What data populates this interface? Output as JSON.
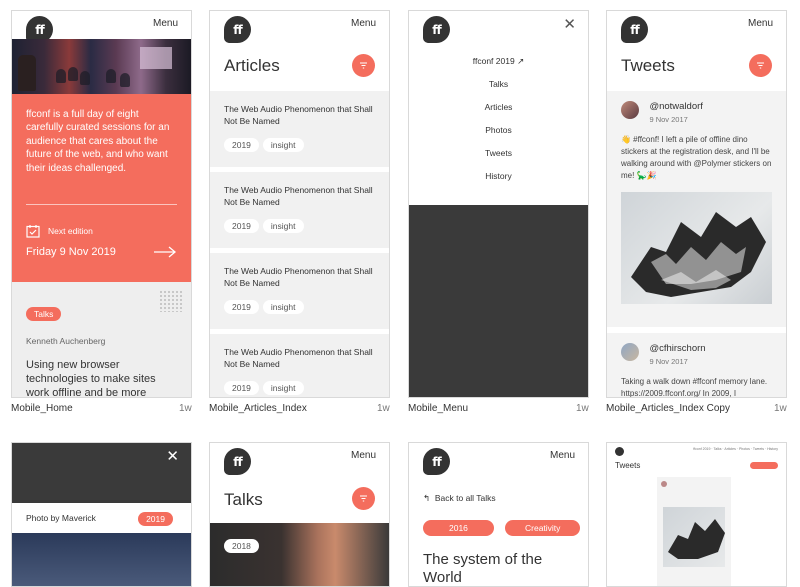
{
  "brand": {
    "logo_text": "ff",
    "coral": "#f46d5d",
    "dark": "#3a3a3a"
  },
  "artboards": [
    {
      "label": "Mobile_Home",
      "age": "1w"
    },
    {
      "label": "Mobile_Articles_Index",
      "age": "1w"
    },
    {
      "label": "Mobile_Menu",
      "age": "1w"
    },
    {
      "label": "Mobile_Articles_Index Copy",
      "age": "1w"
    }
  ],
  "common": {
    "menu": "Menu"
  },
  "home": {
    "intro": "ffconf is a full day of eight carefully curated sessions for an audience that cares about the future of the web, and who want their ideas challenged.",
    "next_label": "Next edition",
    "next_date": "Friday 9 Nov 2019",
    "talk_tag": "Talks",
    "speaker": "Kenneth Auchenberg",
    "talk_title": "Using new browser technologies to make sites work offline and be more"
  },
  "articles": {
    "title": "Articles",
    "items": [
      {
        "title": "The Web Audio Phenomenon that Shall Not Be Named",
        "year": "2019",
        "tag": "insight"
      },
      {
        "title": "The Web Audio Phenomenon that Shall Not Be Named",
        "year": "2019",
        "tag": "insight"
      },
      {
        "title": "The Web Audio Phenomenon that Shall Not Be Named",
        "year": "2019",
        "tag": "insight"
      },
      {
        "title": "The Web Audio Phenomenon that Shall Not Be Named",
        "year": "2019",
        "tag": "insight"
      }
    ]
  },
  "menu_screen": {
    "items": [
      "ffconf 2019",
      "Talks",
      "Articles",
      "Photos",
      "Tweets",
      "History"
    ]
  },
  "tweets": {
    "title": "Tweets",
    "items": [
      {
        "handle": "@notwaldorf",
        "date": "9 Nov 2017",
        "text": "👋 #ffconf! I left a pile of offline dino stickers at the registration desk, and I'll be walking around with @Polymer stickers on me! 🦕🎉"
      },
      {
        "handle": "@cfhirschorn",
        "date": "9 Nov 2017",
        "text": "Taking a walk down #ffconf memory lane. https://2009.ffconf.org/  In 2009, I"
      }
    ]
  },
  "photo_screen": {
    "caption": "Photo by Maverick",
    "year": "2019"
  },
  "talks_screen": {
    "title": "Talks",
    "year": "2018"
  },
  "talk_detail": {
    "back": "Back to all Talks",
    "year": "2016",
    "tag": "Creativity",
    "title": "The system of the World"
  },
  "desktop_tweets": {
    "title": "Tweets",
    "nav": "ffconf 2019 ·  Talks ·  Articles ·  Photos ·  Tweets ·  History"
  }
}
